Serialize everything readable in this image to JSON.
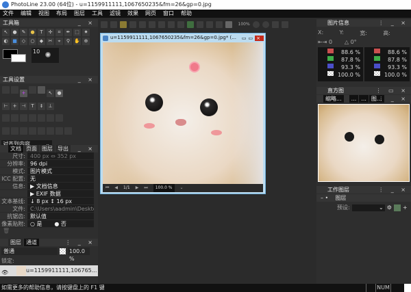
{
  "app": {
    "title": "PhotoLine 23.00 (64位) - u=1159911111,1067650235&fm=26&gp=0.jpg"
  },
  "menu": [
    "文件",
    "编辑",
    "视图",
    "布局",
    "图层",
    "工具",
    "滤镜",
    "效果",
    "网页",
    "窗口",
    "帮助"
  ],
  "toolbox": {
    "title": "工具箱",
    "brush_size": "10"
  },
  "tool_settings": {
    "title": "工具设置",
    "align_select": "对齐到内容"
  },
  "doc_panel": {
    "tabs": [
      "文档",
      "页面",
      "图层",
      "导出"
    ],
    "active_tab": 0,
    "rows": [
      {
        "k": "尺寸:",
        "v": "400 px  ⇔  352 px"
      },
      {
        "k": "分辨率:",
        "v": "96 dpi"
      },
      {
        "k": "模式:",
        "v": "图片模式",
        "dropdown": true
      },
      {
        "k": "ICC 配置:",
        "v": "无"
      },
      {
        "k": "信息:",
        "v": "▶ 文档信息"
      },
      {
        "k": "",
        "v": "▶ EXIF 数据"
      },
      {
        "k": "文本基线:",
        "v": "↓ 8 px        ↕ 16 px"
      },
      {
        "k": "文件:",
        "v": "C:\\Users\\aadmin\\Desktop\\"
      },
      {
        "k": "抗锯齿:",
        "v": "默认值",
        "dropdown": true
      }
    ],
    "pixel_snap": {
      "label": "像素贴附:",
      "options": [
        "是",
        "否"
      ],
      "selected": "否"
    }
  },
  "layers_panel": {
    "tabs": [
      "图层",
      "通道"
    ],
    "active_tab": 1,
    "blend": "普通",
    "opacity": "100.0 %",
    "lock_label": "锁定:",
    "layer_name": "u=1159911111,106765..."
  },
  "document": {
    "title": "u=1159911111,1067650235&fm=26&gp=0.jpg* (...",
    "page": "1/1",
    "zoom": "100.0 %"
  },
  "toolbar": {
    "zoom": "100%"
  },
  "image_info": {
    "title": "图片信息",
    "labels": [
      "X:",
      "Y:",
      "宽:",
      "高:"
    ],
    "offset": "0",
    "angle": "0°",
    "colors": [
      {
        "hex": "#c94f4f",
        "v": "88.6 %"
      },
      {
        "hex": "#3fae4a",
        "v": "87.8 %"
      },
      {
        "hex": "#4a4fc9",
        "v": "93.3 %"
      },
      {
        "hex": "checker",
        "v": "100.0 %"
      }
    ]
  },
  "histogram": {
    "title": "直方图"
  },
  "thumb": {
    "tabs": [
      "缩略...",
      "",
      "...",
      "...",
      "图..."
    ]
  },
  "work_layers": {
    "title": "工作图层",
    "layer": "图层",
    "preset_label": "预设:"
  },
  "statusbar": {
    "help": "如需更多的帮助信息，请按键盘上的 F1 键",
    "num": "NUM"
  }
}
